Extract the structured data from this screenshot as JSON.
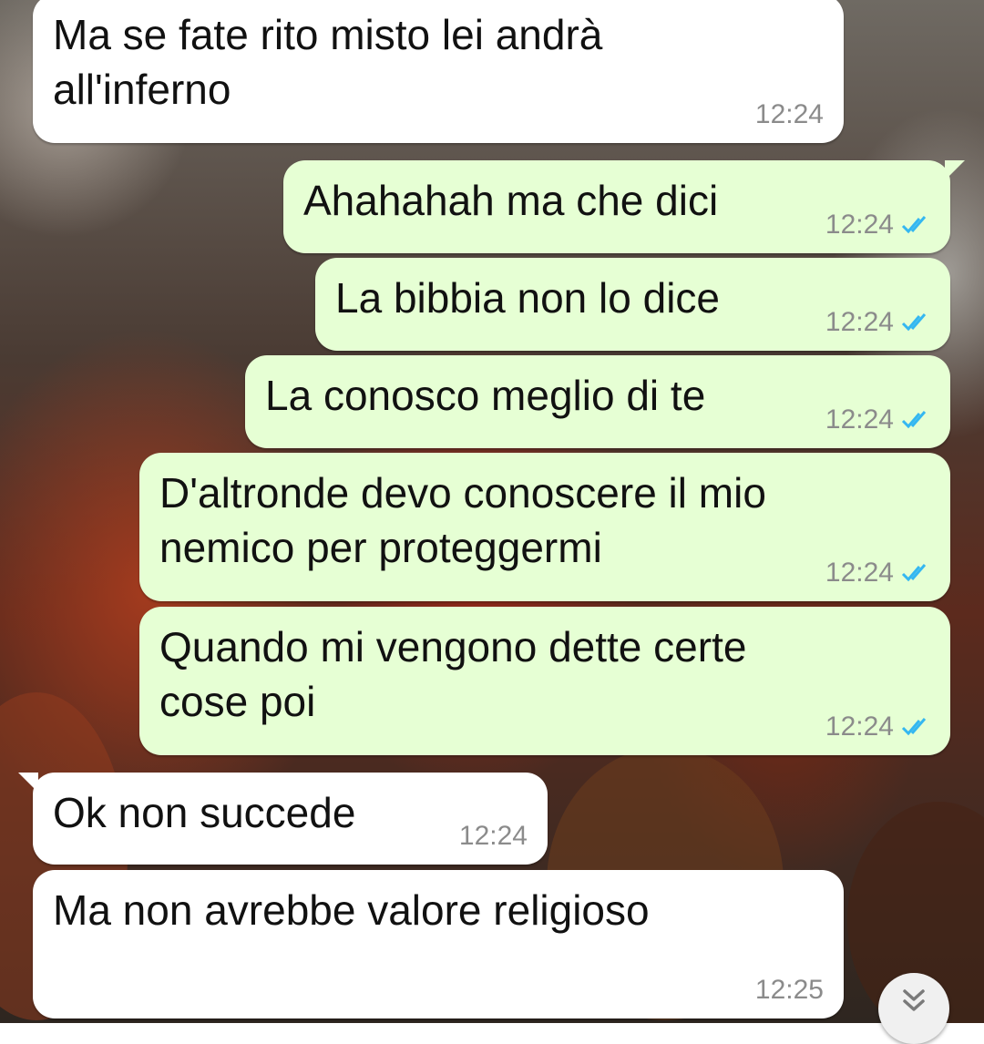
{
  "messages": [
    {
      "direction": "incoming",
      "text": "Ma se fate rito misto lei andrà\nall'inferno",
      "time": "12:24"
    },
    {
      "direction": "outgoing",
      "text": "Ahahahah ma che dici",
      "time": "12:24",
      "status": "read"
    },
    {
      "direction": "outgoing",
      "text": "La bibbia non lo dice",
      "time": "12:24",
      "status": "read"
    },
    {
      "direction": "outgoing",
      "text": "La conosco meglio di te",
      "time": "12:24",
      "status": "read"
    },
    {
      "direction": "outgoing",
      "text": "D'altronde devo conoscere il mio\nnemico per proteggermi",
      "time": "12:24",
      "status": "read"
    },
    {
      "direction": "outgoing",
      "text": "Quando mi vengono dette certe\ncose poi",
      "time": "12:24",
      "status": "read"
    },
    {
      "direction": "incoming",
      "text": "Ok non succede",
      "time": "12:24"
    },
    {
      "direction": "incoming",
      "text": "Ma non avrebbe valore religioso",
      "time": "12:25"
    }
  ],
  "colors": {
    "incoming_bubble": "#ffffff",
    "outgoing_bubble": "#e6ffd4",
    "read_ticks": "#34b7f1",
    "timestamp": "#8b8b8b"
  },
  "icons": {
    "read_receipt": "double-check-icon",
    "scroll_down": "double-chevron-down-icon"
  }
}
